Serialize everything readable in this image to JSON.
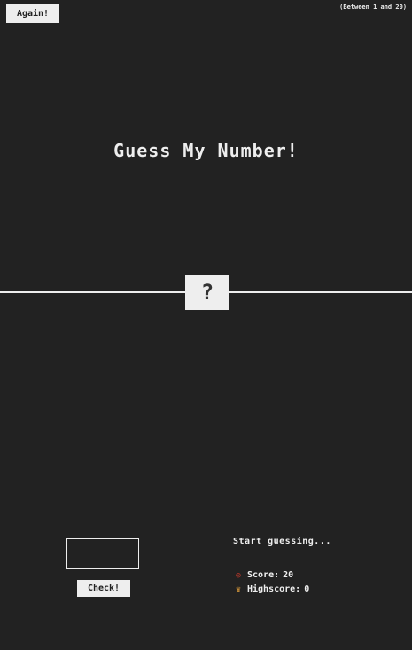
{
  "header": {
    "again_label": "Again!",
    "range_text": "(Between 1 and 20)"
  },
  "main": {
    "title": "Guess My Number!",
    "secret_display": "?"
  },
  "controls": {
    "guess_value": "",
    "check_label": "Check!"
  },
  "status": {
    "message": "Start guessing...",
    "score_label": "Score:",
    "score_value": "20",
    "highscore_label": "Highscore:",
    "highscore_value": "0"
  },
  "icons": {
    "score": "target-icon",
    "highscore": "trophy-icon"
  },
  "colors": {
    "background": "#222222",
    "foreground": "#eeeeee"
  }
}
